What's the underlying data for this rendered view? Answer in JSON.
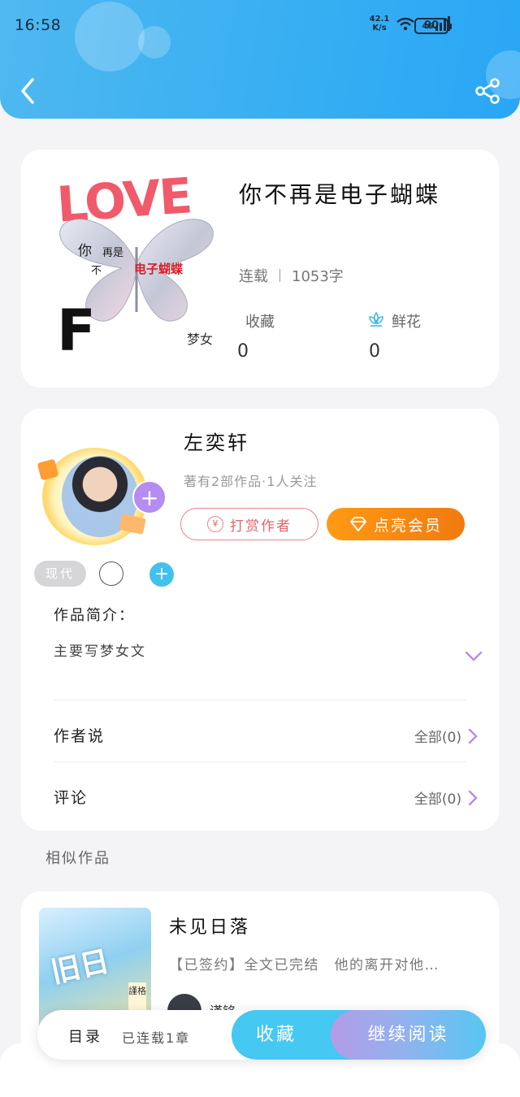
{
  "status_bar": {
    "time": "16:58",
    "net_speed_value": "42.1",
    "net_speed_unit": "K/s",
    "network": "4G",
    "battery": "90"
  },
  "header": {
    "back_icon": "chevron-left-icon",
    "share_icon": "share-icon",
    "gradient_start": "#4fb8f0",
    "gradient_end": "#29a6f5"
  },
  "book": {
    "cover": {
      "love": "LOVE",
      "t1": "你",
      "t2": "再是",
      "t3": "不",
      "t4": "电子蝴蝶",
      "f": "F",
      "mn": "梦女"
    },
    "title": "你不再是电子蝴蝶",
    "status": "连载",
    "word_count": "1053字",
    "favorites_label": "收藏",
    "favorites_count": "0",
    "flowers_label": "鲜花",
    "flowers_count": "0"
  },
  "author": {
    "name": "左奕轩",
    "stats": "著有2部作品·1人关注",
    "follow_symbol": "+",
    "tip_icon_symbol": "¥",
    "tip_label": "打赏作者",
    "vip_label": "点亮会员",
    "tag": "现代",
    "tag_add_symbol": "+"
  },
  "intro": {
    "label": "作品简介：",
    "text": "主要写梦女文"
  },
  "rows": {
    "author_says_label": "作者说",
    "author_says_value": "全部(0)",
    "comments_label": "评论",
    "comments_value": "全部(0)"
  },
  "similar": {
    "section_title": "相似作品",
    "items": [
      {
        "title": "未见日落",
        "desc": "【已签约】全文已完结　他的离开对他…",
        "cover_text": "旧日",
        "cover_tag": "謹格",
        "author": "谨铭"
      }
    ]
  },
  "bottom_bar": {
    "toc_label": "目录",
    "toc_status": "已连载1章",
    "favorite_label": "收藏",
    "read_label": "继续阅读"
  },
  "colors": {
    "accent_blue": "#45c8f2",
    "vip_orange": "#f07a10",
    "tip_red": "#e0646e",
    "purple": "#b58cf0"
  }
}
